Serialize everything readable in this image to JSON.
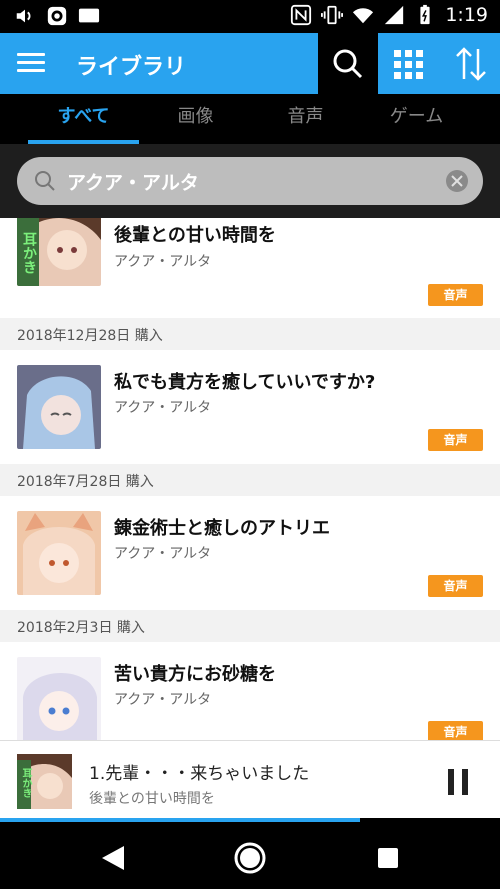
{
  "status_bar": {
    "time": "1:19",
    "icons": [
      "volume-icon",
      "notification-icon",
      "message-icon",
      "nfc-icon",
      "vibrate-icon",
      "wifi-icon",
      "signal-icon",
      "battery-icon"
    ]
  },
  "app_bar": {
    "title": "ライブラリ",
    "icons": [
      "menu-icon",
      "search-icon",
      "grid-icon",
      "sort-icon"
    ]
  },
  "tabs": {
    "items": [
      {
        "label": "すべて",
        "active": true
      },
      {
        "label": "画像",
        "active": false
      },
      {
        "label": "音声",
        "active": false
      },
      {
        "label": "ゲーム",
        "active": false
      }
    ]
  },
  "search": {
    "value": "アクア・アルタ",
    "clear_icon": "clear-icon"
  },
  "library": {
    "items": [
      {
        "title": "後輩との甘い時間を",
        "author": "アクア・アルタ",
        "badge": "音声",
        "thumb_text": "耳かき"
      },
      {
        "date_label": "2018年12月28日 購入",
        "title": "私でも貴方を癒していいですか?",
        "author": "アクア・アルタ",
        "badge": "音声"
      },
      {
        "date_label": "2018年7月28日 購入",
        "title": "錬金術士と癒しのアトリエ",
        "author": "アクア・アルタ",
        "badge": "音声"
      },
      {
        "date_label": "2018年2月3日 購入",
        "title": "苦い貴方にお砂糖を",
        "author": "アクア・アルタ",
        "badge": "音声"
      }
    ]
  },
  "player": {
    "track": "1.先輩・・・来ちゃいました",
    "album": "後輩との甘い時間を",
    "thumb_text": "耳かき",
    "progress_fraction": 0.72
  },
  "colors": {
    "accent": "#29a3ef",
    "badge": "#f5961e"
  }
}
